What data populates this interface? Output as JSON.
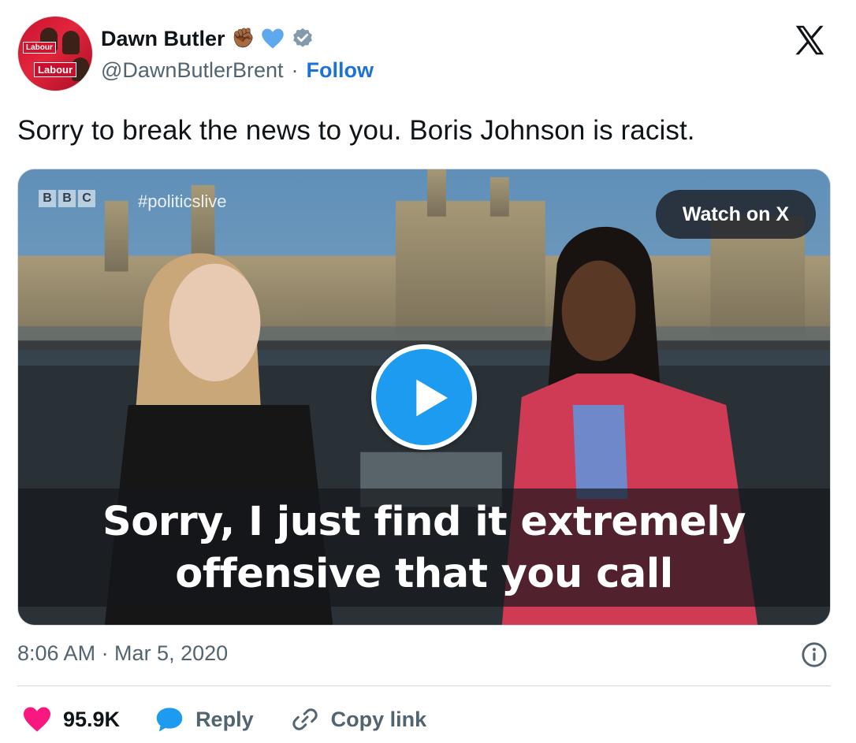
{
  "author": {
    "name": "Dawn Butler",
    "handle": "@DawnButlerBrent",
    "separator": "·",
    "follow_label": "Follow",
    "avatar_sign_small": "Labour",
    "avatar_sign_large": "Labour"
  },
  "tweet": {
    "text": "Sorry to break the news to you. Boris Johnson is racist.",
    "timestamp": "8:06 AM · Mar 5, 2020"
  },
  "video": {
    "channel_letters": [
      "B",
      "B",
      "C"
    ],
    "hashtag": "#politicslive",
    "watch_label": "Watch on X",
    "caption_line1": "Sorry, I just find it extremely",
    "caption_line2": "offensive that you call"
  },
  "actions": {
    "like_count": "95.9K",
    "reply_label": "Reply",
    "copy_link_label": "Copy link"
  },
  "colors": {
    "accent": "#1d9bf0",
    "follow": "#1d72d8",
    "like": "#f91880",
    "muted": "#536471"
  },
  "icons": {
    "emoji_fist": "✊🏾",
    "close": "x-logo-icon",
    "info": "info-icon"
  }
}
